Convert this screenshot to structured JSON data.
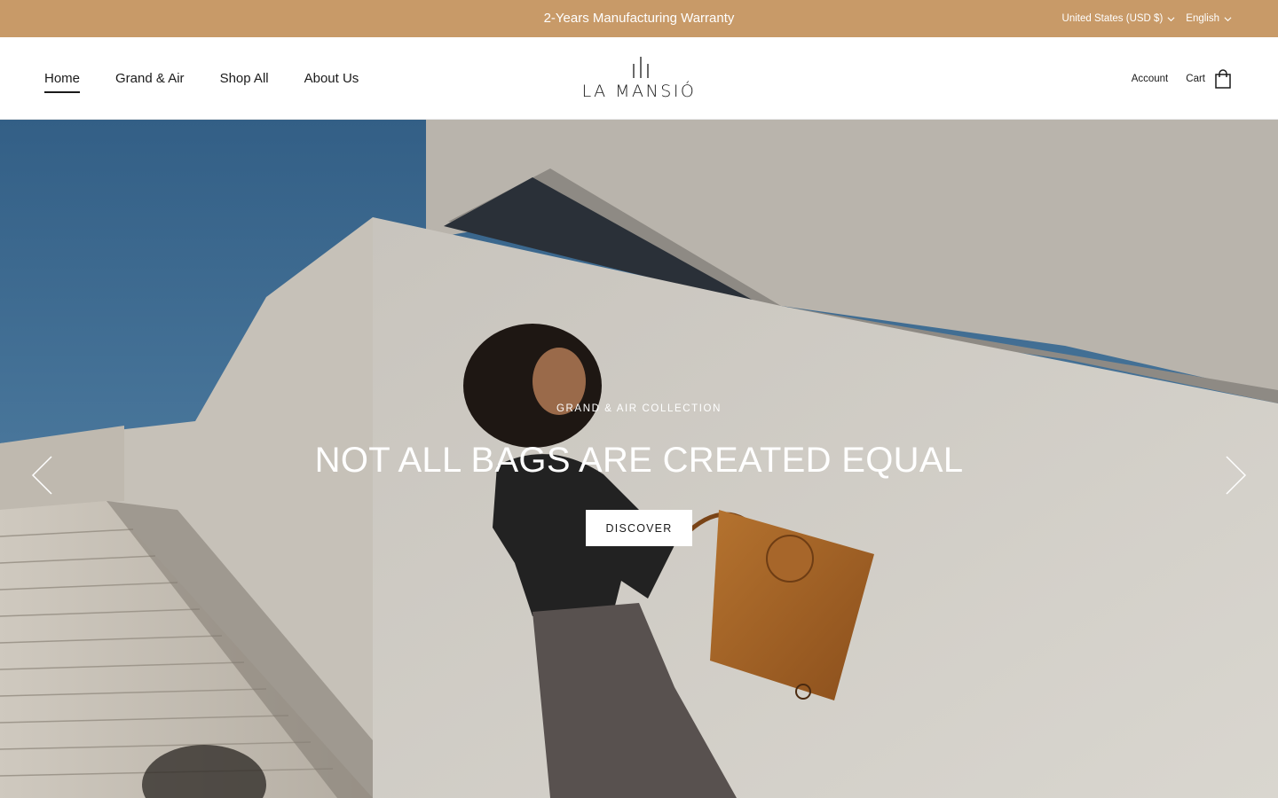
{
  "announcement": {
    "text": "2-Years Manufacturing Warranty",
    "country_selector": "United States (USD $)",
    "language_selector": "English",
    "background_color": "#c89a68"
  },
  "header": {
    "nav": [
      {
        "label": "Home",
        "active": true
      },
      {
        "label": "Grand & Air",
        "active": false
      },
      {
        "label": "Shop All",
        "active": false
      },
      {
        "label": "About Us",
        "active": false
      }
    ],
    "logo_text": "LA MANSIÓ",
    "account_label": "Account",
    "cart_label": "Cart",
    "icons": {
      "cart": "shopping-bag-icon",
      "dropdown": "chevron-down-icon"
    }
  },
  "hero": {
    "eyebrow": "GRAND & AIR COLLECTION",
    "title": "NOT ALL BAGS ARE CREATED EQUAL",
    "button_label": "DISCOVER",
    "icons": {
      "prev": "chevron-left-icon",
      "next": "chevron-right-icon"
    }
  }
}
